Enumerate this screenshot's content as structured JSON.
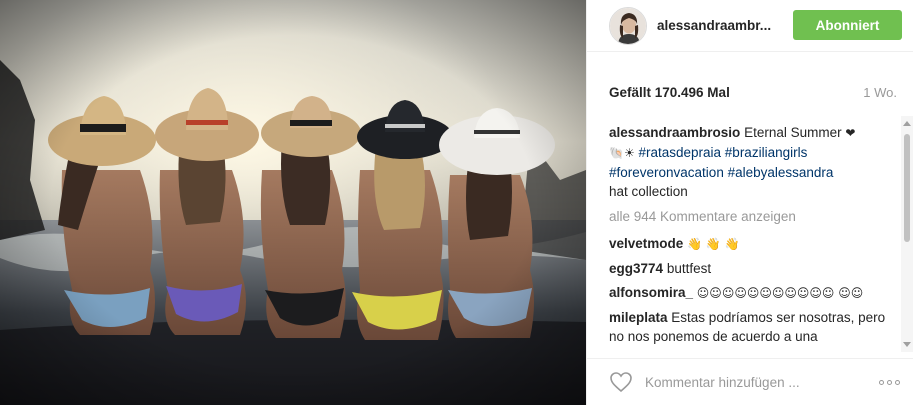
{
  "header": {
    "username": "alessandraambr...",
    "follow_label": "Abonniert"
  },
  "post": {
    "likes": "Gefällt 170.496 Mal",
    "age": "1 Wo."
  },
  "caption": {
    "user": "alessandraambrosio",
    "text": "Eternal Summer",
    "emoji1": "❤",
    "emoji2": "🐚☀",
    "tag1": "#ratasdepraia",
    "tag2": "#braziliangirls",
    "tag3": "#foreveronvacation",
    "tag4": "#alebyalessandra",
    "text2": "hat collection"
  },
  "view_all": "alle 944 Kommentare anzeigen",
  "comments": [
    {
      "user": "velvetmode",
      "text": "👋 👋 👋"
    },
    {
      "user": "egg3774",
      "text": "buttfest"
    },
    {
      "user": "alfonsomira_",
      "text": "☺☺☺☺☺☺☺☺☺☺☺ ☺☺"
    },
    {
      "user": "mileplata",
      "text": "Estas podríamos ser nosotras, pero no nos ponemos de acuerdo a una"
    }
  ],
  "footer": {
    "comment_placeholder": "Kommentar hinzufügen ..."
  },
  "icons": {
    "heart": "heart-icon",
    "more": "more-options-icon",
    "avatar": "avatar"
  }
}
